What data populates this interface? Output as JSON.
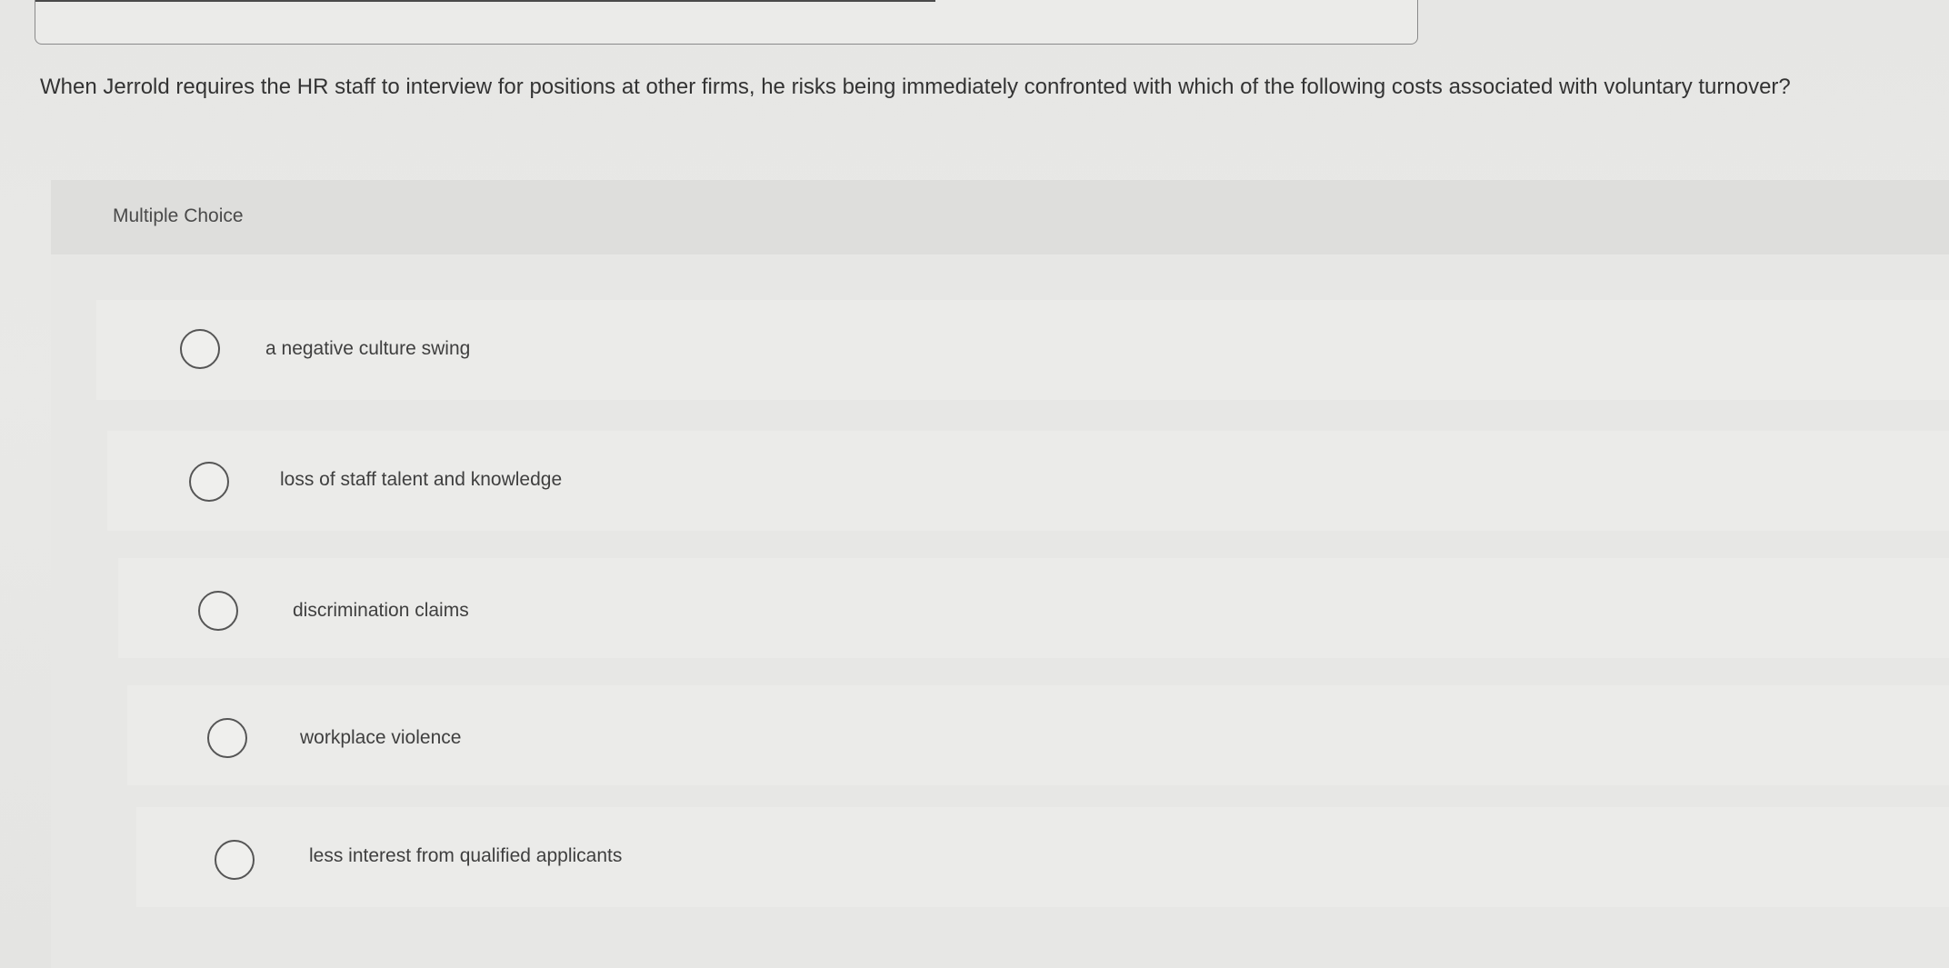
{
  "question": {
    "text": "When Jerrold requires the HR staff to interview for positions at other firms, he risks being immediately confronted with which of the following costs associated with voluntary turnover?"
  },
  "panel": {
    "header": "Multiple Choice"
  },
  "options": [
    {
      "label": "a negative culture swing",
      "selected": false
    },
    {
      "label": "loss of staff talent and knowledge",
      "selected": false
    },
    {
      "label": "discrimination claims",
      "selected": false
    },
    {
      "label": "workplace violence",
      "selected": false
    },
    {
      "label": "less interest from qualified applicants",
      "selected": false
    }
  ]
}
